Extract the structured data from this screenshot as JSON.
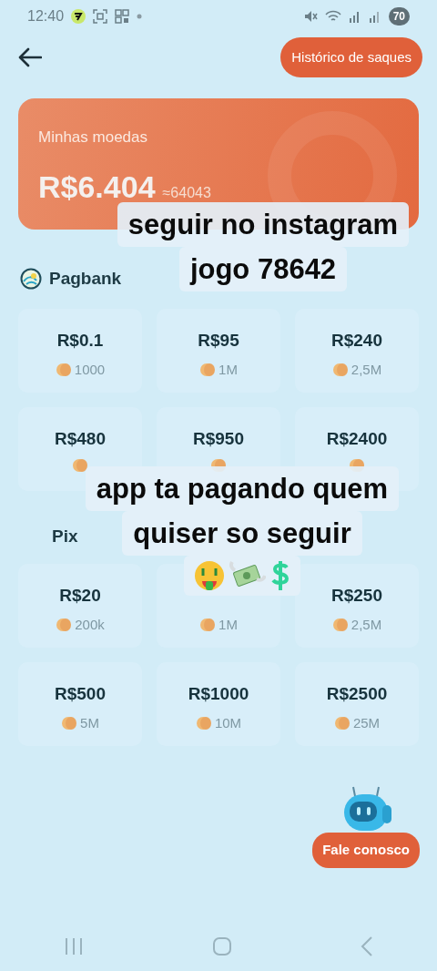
{
  "status_bar": {
    "time": "12:40",
    "battery": "70"
  },
  "header": {
    "history_button": "Histórico de saques"
  },
  "balance_card": {
    "title": "Minhas moedas",
    "amount": "R$6.404",
    "coins": "≈64043"
  },
  "methods": [
    {
      "name": "Pagbank",
      "kind": "pagbank",
      "options": [
        {
          "price": "R$0.1",
          "coins": "1000"
        },
        {
          "price": "R$95",
          "coins": "1M"
        },
        {
          "price": "R$240",
          "coins": "2,5M"
        },
        {
          "price": "R$480"
        },
        {
          "price": "R$950"
        },
        {
          "price": "R$2400"
        }
      ]
    },
    {
      "name": "Pix",
      "kind": "pix",
      "options": [
        {
          "price": "R$20",
          "coins": "200k"
        },
        {
          "coins": "1M"
        },
        {
          "price": "R$250",
          "coins": "2,5M"
        },
        {
          "price": "R$500",
          "coins": "5M"
        },
        {
          "price": "R$1000",
          "coins": "10M"
        },
        {
          "price": "R$2500",
          "coins": "25M"
        }
      ]
    }
  ],
  "contact_button": "Fale conosco",
  "captions": [
    {
      "lines": [
        "seguir no instagram",
        "jogo 78642"
      ],
      "kind": "plain"
    },
    {
      "lines": [
        "app ta pagando quem",
        "quiser so seguir"
      ],
      "kind": "money"
    }
  ]
}
